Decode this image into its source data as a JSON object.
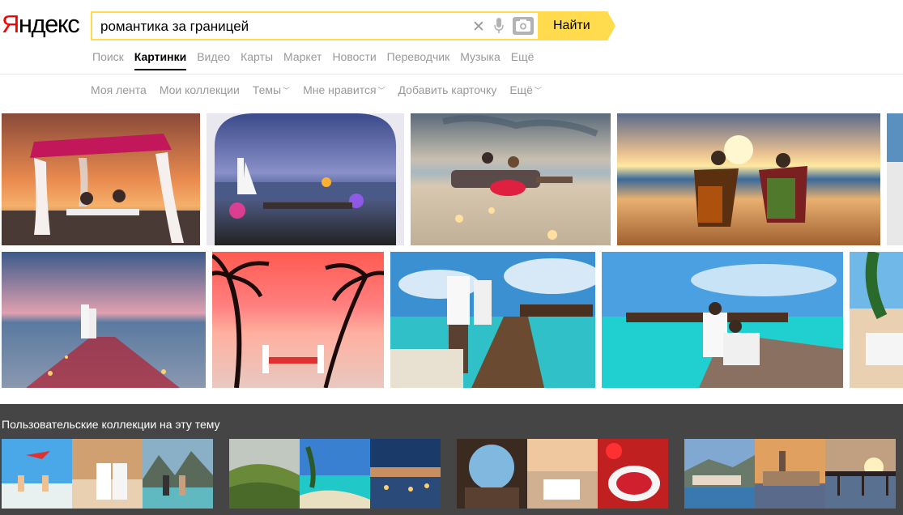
{
  "logo": {
    "first": "Я",
    "rest": "ндекс"
  },
  "search": {
    "query": "романтика за границей",
    "button_label": "Найти"
  },
  "nav": {
    "items": [
      {
        "label": "Поиск",
        "active": false
      },
      {
        "label": "Картинки",
        "active": true
      },
      {
        "label": "Видео",
        "active": false
      },
      {
        "label": "Карты",
        "active": false
      },
      {
        "label": "Маркет",
        "active": false
      },
      {
        "label": "Новости",
        "active": false
      },
      {
        "label": "Переводчик",
        "active": false
      },
      {
        "label": "Музыка",
        "active": false
      },
      {
        "label": "Ещё",
        "active": false
      }
    ]
  },
  "subnav": {
    "items": [
      {
        "label": "Моя лента",
        "dropdown": false
      },
      {
        "label": "Мои коллекции",
        "dropdown": false
      },
      {
        "label": "Темы",
        "dropdown": true
      },
      {
        "label": "Мне нравится",
        "dropdown": true
      },
      {
        "label": "Добавить карточку",
        "dropdown": false
      },
      {
        "label": "Ещё",
        "dropdown": true
      }
    ]
  },
  "collections": {
    "title": "Пользовательские коллекции на эту тему"
  },
  "colors": {
    "accent": "#ffdb4d",
    "logo_red": "#ff0000",
    "bottom_bg": "#454545"
  }
}
